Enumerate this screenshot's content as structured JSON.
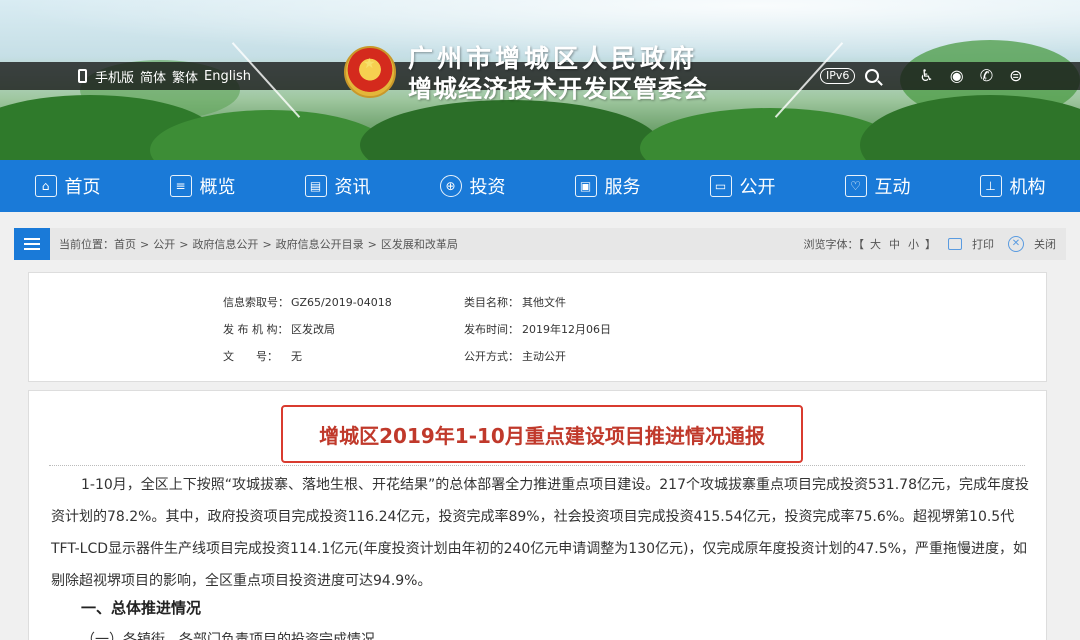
{
  "header": {
    "mobile_label": "手机版",
    "lang_simplified": "简体",
    "lang_traditional": "繁体",
    "lang_english": "English",
    "title_line1": "广州市增城区人民政府",
    "title_line2": "增城经济技术开发区管委会",
    "ipv6_badge": "IPv6",
    "icons": [
      "search-icon",
      "accessibility-icon",
      "weibo-icon",
      "wechat-icon",
      "app-icon"
    ]
  },
  "nav": {
    "items": [
      {
        "label": "首页",
        "icon": "home-icon"
      },
      {
        "label": "概览",
        "icon": "overview-icon"
      },
      {
        "label": "资讯",
        "icon": "news-icon"
      },
      {
        "label": "投资",
        "icon": "globe-icon"
      },
      {
        "label": "服务",
        "icon": "briefcase-icon"
      },
      {
        "label": "公开",
        "icon": "monitor-icon"
      },
      {
        "label": "互动",
        "icon": "chat-icon"
      },
      {
        "label": "机构",
        "icon": "org-chart-icon"
      }
    ]
  },
  "breadcrumb": {
    "label": "当前位置：",
    "items": [
      "首页",
      "公开",
      "政府信息公开",
      "政府信息公开目录",
      "区发展和改革局"
    ],
    "separator": ">",
    "font_label": "浏览字体：【",
    "font_large": "大",
    "font_medium": "中",
    "font_small": "小",
    "font_end": "】",
    "print_label": "打印",
    "close_label": "关闭"
  },
  "info": {
    "index_label": "信息索取号：",
    "index_value": "GZ65/2019-04018",
    "category_label": "类目名称：",
    "category_value": "其他文件",
    "publisher_label": "发 布 机 构：",
    "publisher_value": "区发改局",
    "date_label": "发布时间：",
    "date_value": "2019年12月06日",
    "docno_label": "文　　号：",
    "docno_value": "无",
    "mode_label": "公开方式：",
    "mode_value": "主动公开"
  },
  "article": {
    "title": "增城区2019年1-10月重点建设项目推进情况通报",
    "paragraph": "1-10月，全区上下按照“攻城拔寨、落地生根、开花结果”的总体部署全力推进重点项目建设。217个攻城拔寨重点项目完成投资531.78亿元，完成年度投资计划的78.2%。其中，政府投资项目完成投资116.24亿元，投资完成率89%，社会投资项目完成投资415.54亿元，投资完成率75.6%。超视堺第10.5代TFT-LCD显示器件生产线项目完成投资114.1亿元(年度投资计划由年初的240亿元申请调整为130亿元)，仅完成原年度投资计划的47.5%，严重拖慢进度，如剔除超视堺项目的影响，全区重点项目投资进度可达94.9%。",
    "section1": "一、总体推进情况",
    "subsection1": "（一）各镇街、各部门负责项目的投资完成情况"
  }
}
